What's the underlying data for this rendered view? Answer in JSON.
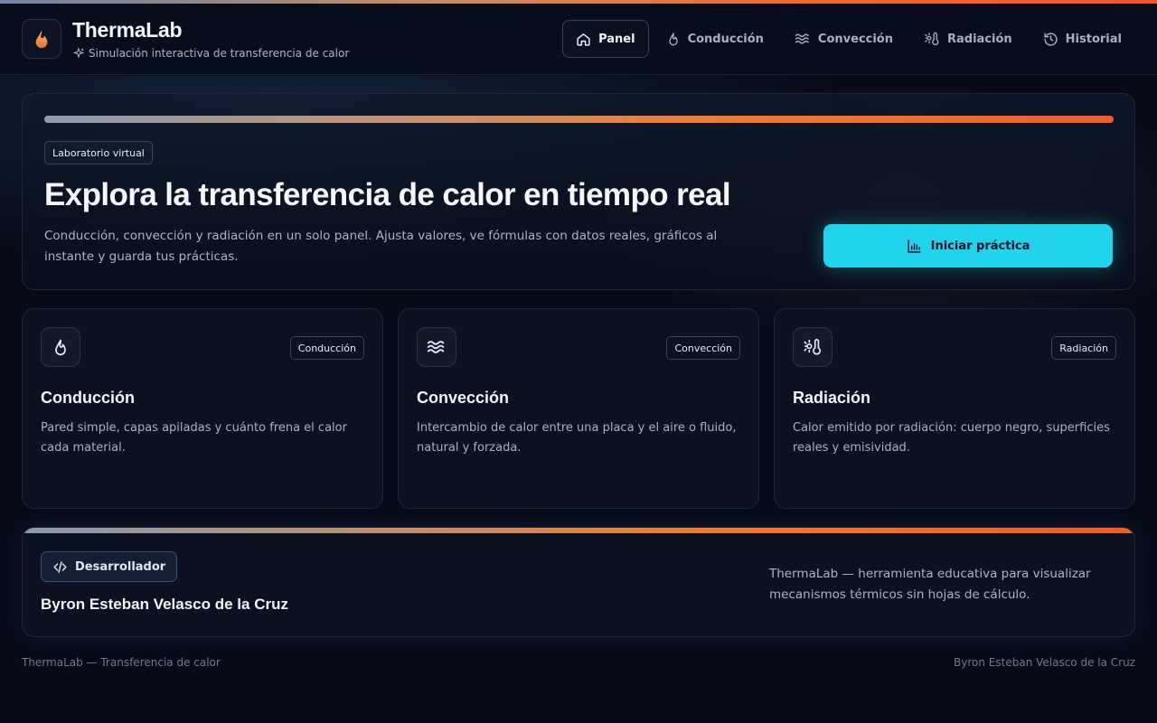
{
  "app": {
    "title": "ThermaLab",
    "subtitle": "Simulación interactiva de transferencia de calor"
  },
  "nav": {
    "items": [
      {
        "label": "Panel",
        "icon": "home-icon",
        "active": true
      },
      {
        "label": "Conducción",
        "icon": "flame-icon",
        "active": false
      },
      {
        "label": "Convección",
        "icon": "waves-icon",
        "active": false
      },
      {
        "label": "Radiación",
        "icon": "sun-thermometer-icon",
        "active": false
      },
      {
        "label": "Historial",
        "icon": "history-icon",
        "active": false
      }
    ]
  },
  "hero": {
    "badge": "Laboratorio virtual",
    "title": "Explora la transferencia de calor en tiempo real",
    "description": "Conducción, convección y radiación en un solo panel. Ajusta valores, ve fórmulas con datos reales, gráficos al instante y guarda tus prácticas.",
    "cta_label": "Iniciar práctica"
  },
  "cards": [
    {
      "tag": "Conducción",
      "title": "Conducción",
      "description": "Pared simple, capas apiladas y cuánto frena el calor cada material.",
      "icon": "flame-icon"
    },
    {
      "tag": "Convección",
      "title": "Convección",
      "description": "Intercambio de calor entre una placa y el aire o fluido, natural y forzada.",
      "icon": "waves-icon"
    },
    {
      "tag": "Radiación",
      "title": "Radiación",
      "description": "Calor emitido por radiación: cuerpo negro, superficies reales y emisividad.",
      "icon": "sun-thermometer-icon"
    }
  ],
  "developer": {
    "badge": "Desarrollador",
    "name": "Byron Esteban Velasco de la Cruz",
    "about": "ThermaLab — herramienta educativa para visualizar mecanismos térmicos sin hojas de cálculo."
  },
  "footer": {
    "left": "ThermaLab — Transferencia de calor",
    "right": "Byron Esteban Velasco de la Cruz"
  },
  "colors": {
    "accent": "#22d3ee",
    "flame": "#f2782f",
    "background": "#070b18"
  }
}
